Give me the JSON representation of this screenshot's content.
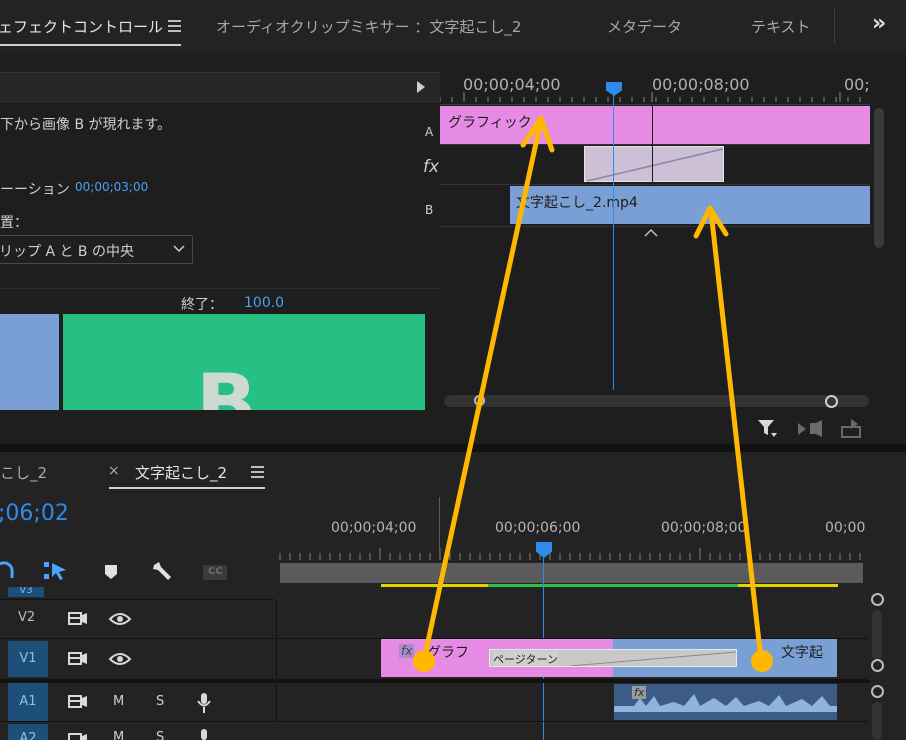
{
  "tabs": {
    "effect_controls": "ェフェクトコントロール",
    "audio_mixer": "オーディオクリップミキサー ：文字起こし_2",
    "metadata": "メタデータ",
    "text": "テキスト",
    "more": "»"
  },
  "effect_controls": {
    "description": "下から画像 B が現れます。",
    "duration_label": "ーーション",
    "duration_value": "00;00;03;00",
    "alignment_label": "置：",
    "alignment_value": "リップ A と B の中央",
    "end_label": "終了：",
    "end_value": "100.0",
    "preview_letter": "B",
    "mini_timeline": {
      "timecodes": [
        "00;00;04;00",
        "00;00;08;00",
        "00;"
      ],
      "track_a": "A",
      "track_b": "B",
      "fx_label": "fx",
      "clip_graphic": "グラフィック",
      "clip_video": "文字起こし_2.mp4"
    }
  },
  "sequence": {
    "tab_prev": "こし_2",
    "tab_close": "×",
    "tab_active": "文字起こし_2",
    "timecode": ";06;02",
    "ruler_timecodes": [
      "00;00;04;00",
      "00;00;06;00",
      "00;00;08;00",
      "00;00"
    ],
    "tools": {
      "cc": "CC"
    },
    "tracks": {
      "v3": "V3",
      "v2": "V2",
      "v1": "V1",
      "a1": "A1",
      "a2": "A2",
      "mute": "M",
      "solo": "S"
    },
    "clips": {
      "graphic": "グラフ",
      "transition": "ページターン",
      "video": "文字起",
      "fx": "fx"
    }
  },
  "colors": {
    "accent": "#2d8ceb",
    "graphic_clip": "#e68be4",
    "video_clip": "#7a9fd4",
    "preview_green": "#27c084",
    "annotation": "#ffb800"
  }
}
